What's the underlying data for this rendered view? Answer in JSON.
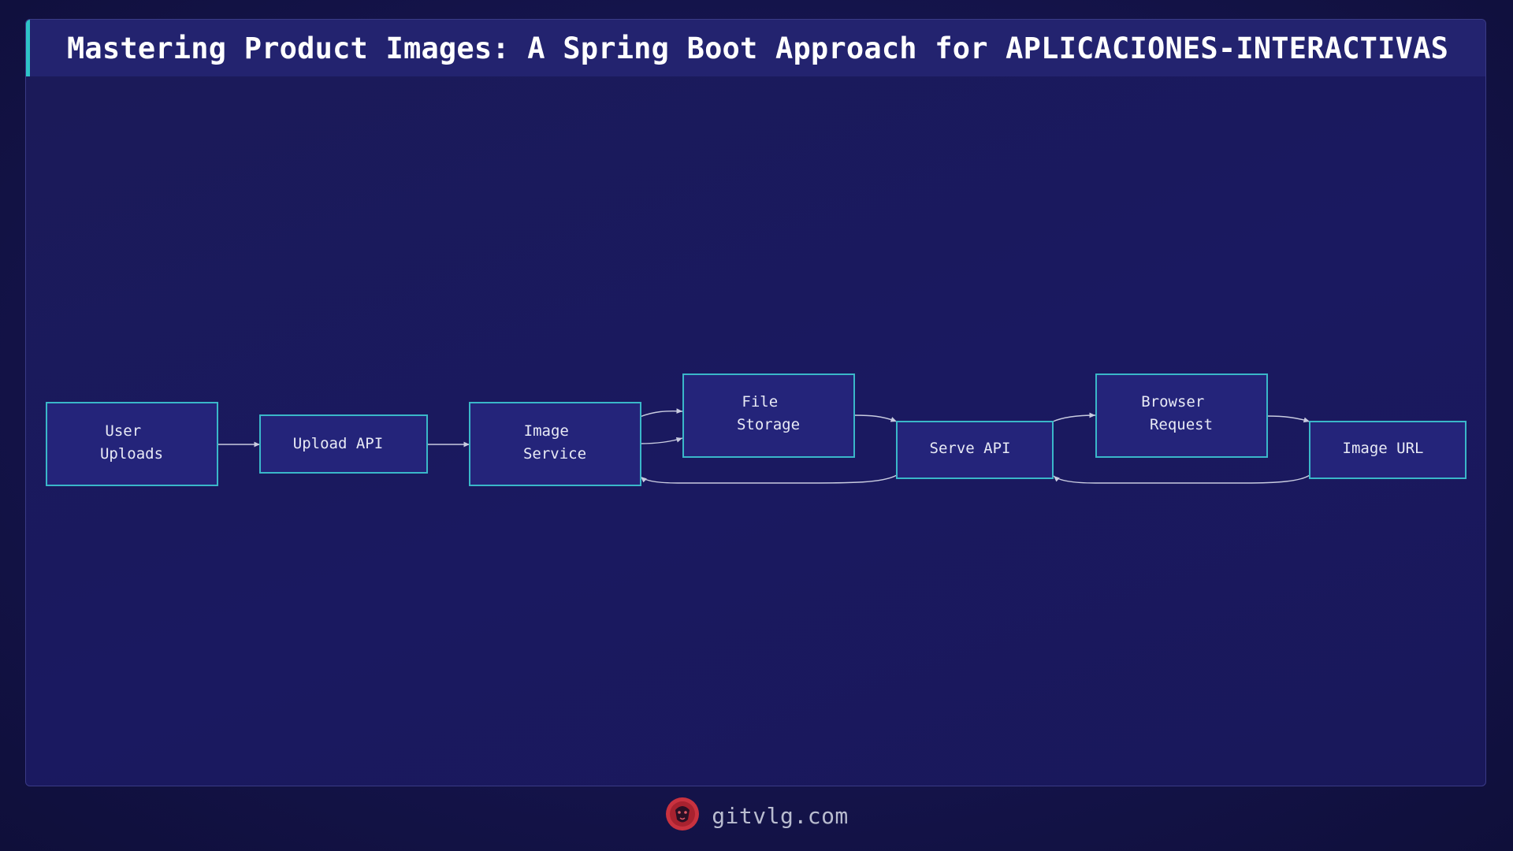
{
  "title": "Mastering Product Images: A Spring Boot Approach for APLICACIONES-INTERACTIVAS",
  "diagram": {
    "nodes": {
      "user_uploads": [
        "User",
        "Uploads"
      ],
      "upload_api": [
        "Upload API"
      ],
      "image_service": [
        "Image",
        "Service"
      ],
      "file_storage": [
        "File",
        "Storage"
      ],
      "serve_api": [
        "Serve API"
      ],
      "browser_request": [
        "Browser",
        "Request"
      ],
      "image_url": [
        "Image URL"
      ]
    },
    "edges": [
      {
        "from": "user_uploads",
        "to": "upload_api"
      },
      {
        "from": "upload_api",
        "to": "image_service"
      },
      {
        "from": "image_service",
        "to": "file_storage"
      },
      {
        "from": "image_service",
        "to": "file_storage"
      },
      {
        "from": "file_storage",
        "to": "serve_api"
      },
      {
        "from": "serve_api",
        "to": "image_service"
      },
      {
        "from": "serve_api",
        "to": "browser_request"
      },
      {
        "from": "browser_request",
        "to": "image_url"
      },
      {
        "from": "image_url",
        "to": "serve_api"
      }
    ],
    "colors": {
      "node_fill": "#24247a",
      "node_border": "#3ab7c9",
      "title_accent": "#2ec4c8",
      "edge": "#c9cce0"
    }
  },
  "footer": {
    "site": "gitvlg.com",
    "logo_icon": "lion-head-icon"
  }
}
